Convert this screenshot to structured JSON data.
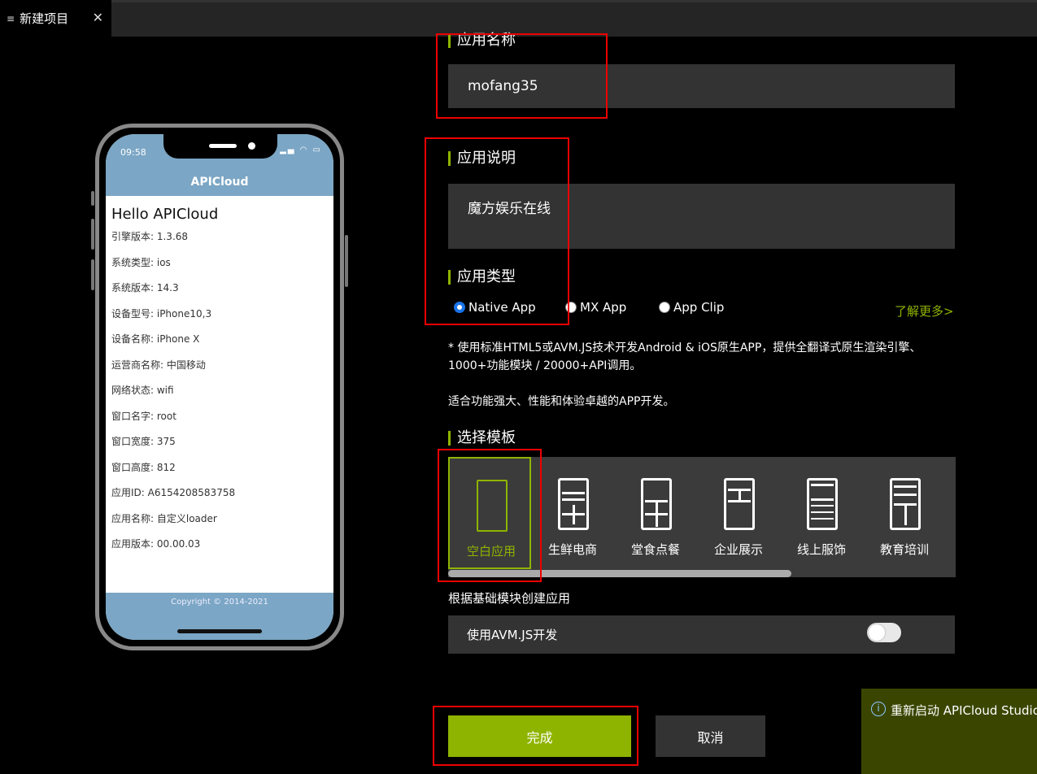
{
  "tab": {
    "label": "新建项目",
    "close": "✕",
    "menu_icon": "≡"
  },
  "phone": {
    "time": "09:58",
    "status_icons": "▂▄ ◠ ▭",
    "nav_title": "APICloud",
    "hello": "Hello APICloud",
    "lines": [
      "引擎版本: 1.3.68",
      "系统类型: ios",
      "系统版本: 14.3",
      "设备型号: iPhone10,3",
      "设备名称: iPhone X",
      "运营商名称: 中国移动",
      "网络状态: wifi",
      "窗口名字: root",
      "窗口宽度: 375",
      "窗口高度: 812",
      "应用ID: A6154208583758",
      "应用名称: 自定义loader",
      "应用版本: 00.00.03"
    ],
    "copyright": "Copyright © 2014-2021"
  },
  "form": {
    "app_name_label": "应用名称",
    "app_name_value": "mofang35",
    "app_desc_label": "应用说明",
    "app_desc_value": "魔方娱乐在线",
    "app_type_label": "应用类型",
    "types": [
      {
        "label": "Native App",
        "selected": true
      },
      {
        "label": "MX App",
        "selected": false
      },
      {
        "label": "App Clip",
        "selected": false
      }
    ],
    "learn_more": "了解更多>",
    "desc1": "* 使用标准HTML5或AVM.JS技术开发Android & iOS原生APP，提供全翻译式原生渲染引擎、1000+功能模块 / 20000+API调用。",
    "desc2": "适合功能强大、性能和体验卓越的APP开发。",
    "template_label": "选择模板",
    "templates": [
      "空白应用",
      "生鲜电商",
      "堂食点餐",
      "企业展示",
      "线上服饰",
      "教育培训"
    ],
    "base_module_text": "根据基础模块创建应用",
    "avm_label": "使用AVM.JS开发",
    "avm_enabled": false,
    "done": "完成",
    "cancel": "取消"
  },
  "notification": {
    "icon": "i",
    "text": "重新启动 APICloud Studio"
  },
  "colors": {
    "accent": "#8fb400",
    "highlight": "#e00000",
    "phone_bar": "#7ba6c5"
  }
}
